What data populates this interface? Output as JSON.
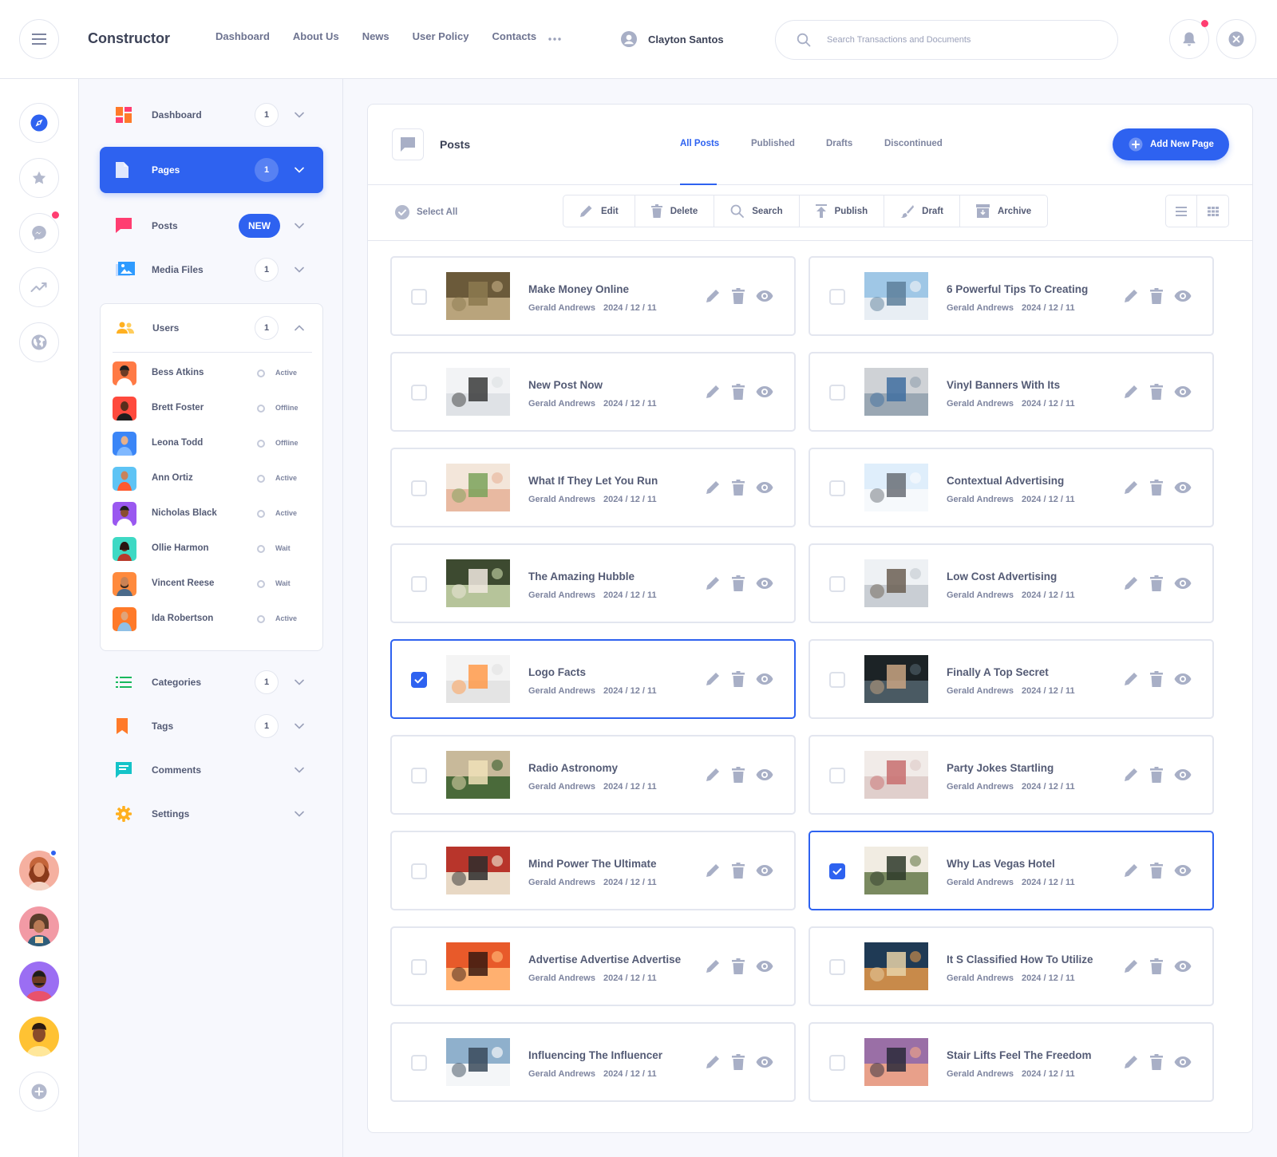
{
  "header": {
    "brand": "Constructor",
    "nav": [
      "Dashboard",
      "About Us",
      "News",
      "User Policy",
      "Contacts"
    ],
    "user_name": "Clayton Santos",
    "search_placeholder": "Search Transactions and Documents"
  },
  "sidebar": {
    "items": [
      {
        "label": "Dashboard",
        "badge": "1"
      },
      {
        "label": "Pages",
        "badge": "1"
      },
      {
        "label": "Posts",
        "badge": "NEW"
      },
      {
        "label": "Media Files",
        "badge": "1"
      },
      {
        "label": "Users",
        "badge": "1"
      },
      {
        "label": "Categories",
        "badge": "1"
      },
      {
        "label": "Tags",
        "badge": "1"
      },
      {
        "label": "Comments"
      },
      {
        "label": "Settings"
      }
    ],
    "users": [
      {
        "name": "Bess Atkins",
        "status": "Active"
      },
      {
        "name": "Brett Foster",
        "status": "Offline"
      },
      {
        "name": "Leona Todd",
        "status": "Offline"
      },
      {
        "name": "Ann Ortiz",
        "status": "Active"
      },
      {
        "name": "Nicholas Black",
        "status": "Active"
      },
      {
        "name": "Ollie Harmon",
        "status": "Wait"
      },
      {
        "name": "Vincent Reese",
        "status": "Wait"
      },
      {
        "name": "Ida Robertson",
        "status": "Active"
      }
    ]
  },
  "panel": {
    "title": "Posts",
    "tabs": [
      "All Posts",
      "Published",
      "Drafts",
      "Discontinued"
    ],
    "add_label": "Add New Page",
    "select_all": "Select All",
    "actions": [
      "Edit",
      "Delete",
      "Search",
      "Publish",
      "Draft",
      "Archive"
    ]
  },
  "posts": [
    {
      "title": "Make Money Online",
      "author": "Gerald Andrews",
      "date": "2024 / 12 / 11",
      "checked": false
    },
    {
      "title": "6 Powerful Tips To Creating",
      "author": "Gerald Andrews",
      "date": "2024 / 12 / 11",
      "checked": false
    },
    {
      "title": "New Post Now",
      "author": "Gerald Andrews",
      "date": "2024 / 12 / 11",
      "checked": false
    },
    {
      "title": "Vinyl Banners With Its",
      "author": "Gerald Andrews",
      "date": "2024 / 12 / 11",
      "checked": false
    },
    {
      "title": "What If They Let You Run",
      "author": "Gerald Andrews",
      "date": "2024 / 12 / 11",
      "checked": false
    },
    {
      "title": "Contextual Advertising",
      "author": "Gerald Andrews",
      "date": "2024 / 12 / 11",
      "checked": false
    },
    {
      "title": "The Amazing Hubble",
      "author": "Gerald Andrews",
      "date": "2024 / 12 / 11",
      "checked": false
    },
    {
      "title": "Low Cost Advertising",
      "author": "Gerald Andrews",
      "date": "2024 / 12 / 11",
      "checked": false
    },
    {
      "title": "Logo Facts",
      "author": "Gerald Andrews",
      "date": "2024 / 12 / 11",
      "checked": true
    },
    {
      "title": "Finally A Top Secret",
      "author": "Gerald Andrews",
      "date": "2024 / 12 / 11",
      "checked": false
    },
    {
      "title": "Radio Astronomy",
      "author": "Gerald Andrews",
      "date": "2024 / 12 / 11",
      "checked": false
    },
    {
      "title": "Party Jokes Startling",
      "author": "Gerald Andrews",
      "date": "2024 / 12 / 11",
      "checked": false
    },
    {
      "title": "Mind Power The Ultimate",
      "author": "Gerald Andrews",
      "date": "2024 / 12 / 11",
      "checked": false
    },
    {
      "title": "Why Las Vegas Hotel",
      "author": "Gerald Andrews",
      "date": "2024 / 12 / 11",
      "checked": true
    },
    {
      "title": "Advertise Advertise Advertise",
      "author": "Gerald Andrews",
      "date": "2024 / 12 / 11",
      "checked": false
    },
    {
      "title": "It S Classified How To Utilize",
      "author": "Gerald Andrews",
      "date": "2024 / 12 / 11",
      "checked": false
    },
    {
      "title": "Influencing The Influencer",
      "author": "Gerald Andrews",
      "date": "2024 / 12 / 11",
      "checked": false
    },
    {
      "title": "Stair Lifts Feel The Freedom",
      "author": "Gerald Andrews",
      "date": "2024 / 12 / 11",
      "checked": false
    }
  ],
  "colors": {
    "accent": "#2e62f0",
    "notification": "#ff3d71"
  }
}
